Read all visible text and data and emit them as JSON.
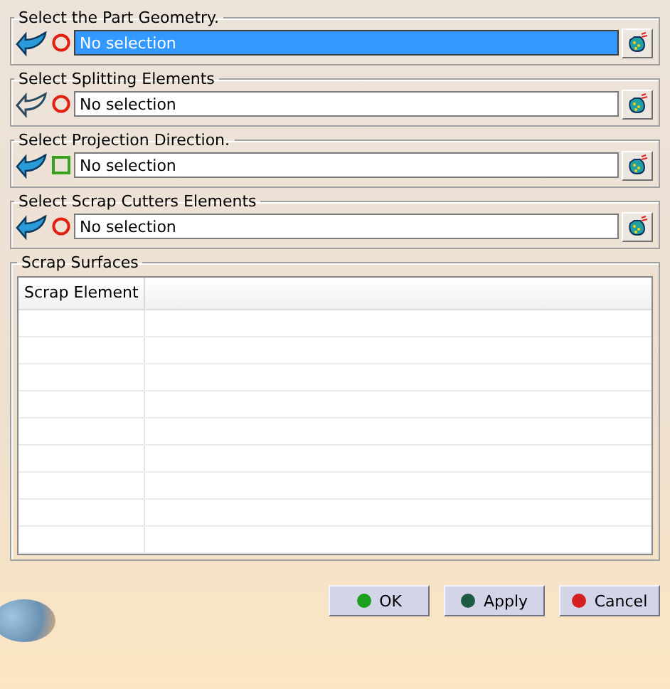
{
  "sections": [
    {
      "title": "Select the Part Geometry.",
      "arrow": {
        "kind": "solid"
      },
      "marker": {
        "kind": "circle"
      },
      "value": "No selection",
      "selected": true
    },
    {
      "title": "Select Splitting Elements",
      "arrow": {
        "kind": "outline"
      },
      "marker": {
        "kind": "circle"
      },
      "value": "No selection",
      "selected": false
    },
    {
      "title": "Select Projection Direction.",
      "arrow": {
        "kind": "solid"
      },
      "marker": {
        "kind": "square"
      },
      "value": "No selection",
      "selected": false
    },
    {
      "title": "Select Scrap Cutters Elements",
      "arrow": {
        "kind": "solid"
      },
      "marker": {
        "kind": "circle"
      },
      "value": "No selection",
      "selected": false
    }
  ],
  "scrap_surfaces": {
    "title": "Scrap Surfaces",
    "columns": [
      "Scrap Element"
    ]
  },
  "buttons": [
    {
      "label": "OK",
      "color": "#1aa01a"
    },
    {
      "label": "Apply",
      "color": "#1f5a45"
    },
    {
      "label": "Cancel",
      "color": "#d42020"
    }
  ]
}
